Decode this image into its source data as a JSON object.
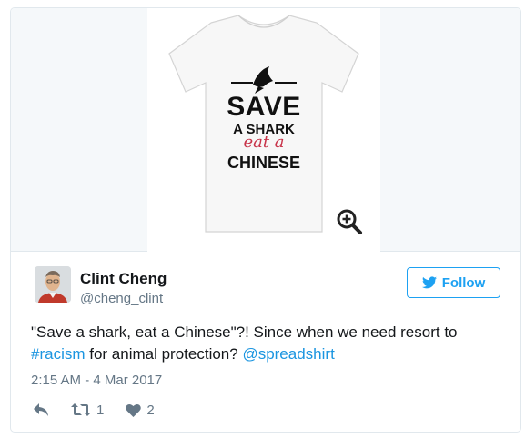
{
  "media": {
    "shirt_lines": [
      "SAVE",
      "A SHARK",
      "eat a",
      "CHINESE"
    ]
  },
  "user": {
    "name": "Clint Cheng",
    "handle": "@cheng_clint"
  },
  "follow_button": {
    "label": "Follow"
  },
  "tweet": {
    "text_before": "\"Save a shark, eat a Chinese\"?! Since when we need resort to",
    "hashtag": "#racism",
    "text_middle": " for animal protection? ",
    "mention": "@spreadshirt"
  },
  "timestamp": "2:15 AM - 4 Mar 2017",
  "actions": {
    "retweet_count": "1",
    "like_count": "2"
  },
  "colors": {
    "link": "#1b95e0",
    "follow_blue": "#1da1f2",
    "muted": "#657786",
    "shirt_accent": "#c8344a"
  },
  "icons": [
    "zoom-in-icon",
    "twitter-bird-icon",
    "reply-icon",
    "retweet-icon",
    "heart-icon"
  ]
}
